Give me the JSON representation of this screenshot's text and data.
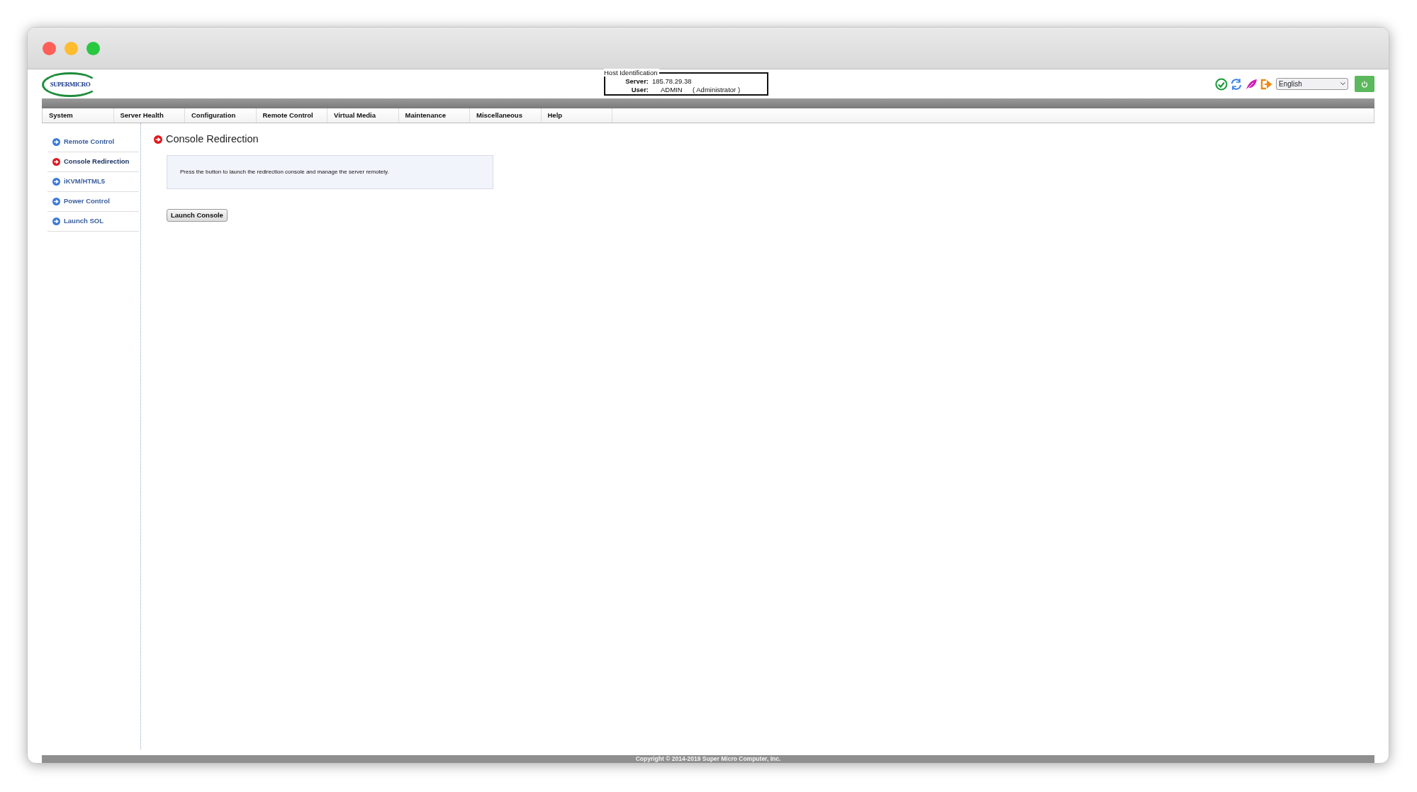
{
  "header": {
    "logo_text": "SUPERMICRO",
    "host_identification": {
      "legend": "Host Identification",
      "server_label": "Server:",
      "server_value": "185.78.29.38",
      "user_label": "User:",
      "user_value": "ADMIN",
      "user_role": "( Administrator )"
    },
    "language": "English"
  },
  "menu": [
    {
      "label": "System"
    },
    {
      "label": "Server Health"
    },
    {
      "label": "Configuration"
    },
    {
      "label": "Remote Control"
    },
    {
      "label": "Virtual Media"
    },
    {
      "label": "Maintenance"
    },
    {
      "label": "Miscellaneous"
    },
    {
      "label": "Help"
    }
  ],
  "sidebar": {
    "items": [
      {
        "label": "Remote Control",
        "selected": false
      },
      {
        "label": "Console Redirection",
        "selected": true
      },
      {
        "label": "iKVM/HTML5",
        "selected": false
      },
      {
        "label": "Power Control",
        "selected": false
      },
      {
        "label": "Launch SOL",
        "selected": false
      }
    ]
  },
  "content": {
    "title": "Console Redirection",
    "info": "Press the button to launch the redirection console and manage the server remotely.",
    "button": "Launch Console"
  },
  "footer": "Copyright © 2014-2019 Super Micro Computer, Inc."
}
